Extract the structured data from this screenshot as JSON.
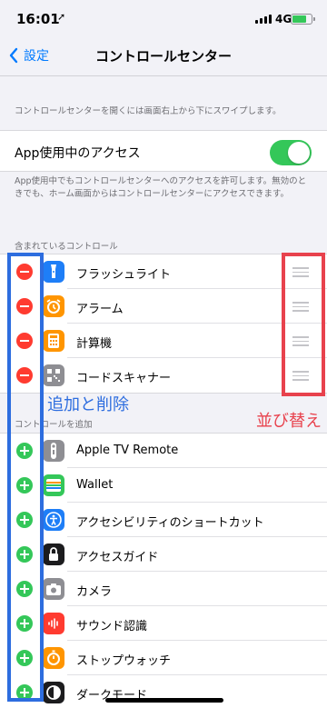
{
  "status_bar": {
    "time": "16:01",
    "network": "4G",
    "battery_level": 0.75
  },
  "nav": {
    "back_label": "設定",
    "title": "コントロールセンター"
  },
  "intro_note": "コントロールセンターを開くには画面右上から下にスワイプします。",
  "access": {
    "label": "App使用中のアクセス",
    "enabled": true,
    "note": "App使用中でもコントロールセンターへのアクセスを許可します。無効のときでも、ホーム画面からはコントロールセンターにアクセスできます。"
  },
  "included": {
    "header": "含まれているコントロール",
    "items": [
      {
        "label": "フラッシュライト",
        "icon": "flashlight-icon",
        "color": "#1e7ef7"
      },
      {
        "label": "アラーム",
        "icon": "alarm-clock-icon",
        "color": "#ff9500"
      },
      {
        "label": "計算機",
        "icon": "calculator-icon",
        "color": "#ff9500"
      },
      {
        "label": "コードスキャナー",
        "icon": "qr-code-icon",
        "color": "#8e8e93"
      }
    ]
  },
  "more": {
    "header": "コントロールを追加",
    "items": [
      {
        "label": "Apple TV Remote",
        "icon": "tv-remote-icon",
        "color": "#8e8e93"
      },
      {
        "label": "Wallet",
        "icon": "wallet-icon",
        "color": "#34c759"
      },
      {
        "label": "アクセシビリティのショートカット",
        "icon": "accessibility-icon",
        "color": "#1e7ef7"
      },
      {
        "label": "アクセスガイド",
        "icon": "lock-icon",
        "color": "#1c1c1e"
      },
      {
        "label": "カメラ",
        "icon": "camera-icon",
        "color": "#8e8e93"
      },
      {
        "label": "サウンド認識",
        "icon": "sound-recognition-icon",
        "color": "#ff3b30"
      },
      {
        "label": "ストップウォッチ",
        "icon": "stopwatch-icon",
        "color": "#ff9500"
      },
      {
        "label": "ダークモード",
        "icon": "dark-mode-icon",
        "color": "#1c1c1e"
      }
    ]
  },
  "annotations": {
    "add_remove": "追加と削除",
    "reorder": "並び替え",
    "blue": "#2d6ddf",
    "red": "#e8424d"
  }
}
